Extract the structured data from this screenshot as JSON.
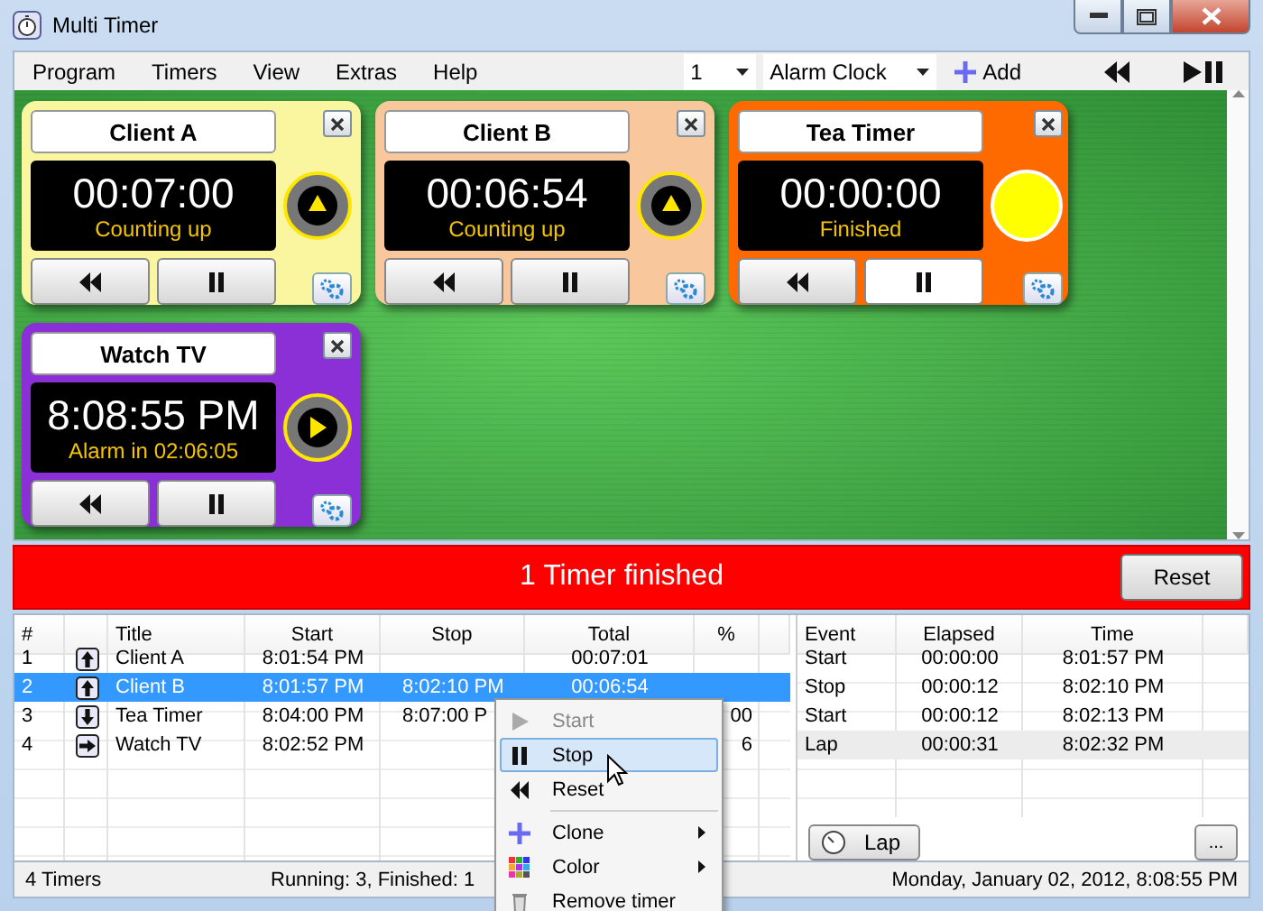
{
  "window": {
    "title": "Multi Timer"
  },
  "menu": [
    "Program",
    "Timers",
    "View",
    "Extras",
    "Help"
  ],
  "toolbar": {
    "count": "1",
    "preset": "Alarm Clock",
    "add": "Add"
  },
  "timers": [
    {
      "title": "Client A",
      "time": "00:07:00",
      "status": "Counting up",
      "color": "#faf6a0",
      "kind": "up"
    },
    {
      "title": "Client B",
      "time": "00:06:54",
      "status": "Counting up",
      "color": "#f8c89c",
      "kind": "up"
    },
    {
      "title": "Tea Timer",
      "time": "00:00:00",
      "status": "Finished",
      "color": "#ff6a00",
      "kind": "done"
    },
    {
      "title": "Watch TV",
      "time": "8:08:55 PM",
      "status": "Alarm in 02:06:05",
      "color": "#8b2fd6",
      "kind": "alarm"
    }
  ],
  "banner": {
    "text": "1 Timer finished",
    "button": "Reset"
  },
  "table": {
    "columns": [
      "#",
      "Title",
      "Start",
      "Stop",
      "Total",
      "%"
    ],
    "rows": [
      {
        "cells": [
          "1",
          "Client A",
          "8:01:54 PM",
          "",
          "00:07:01",
          ""
        ],
        "kind": "up",
        "selected": false
      },
      {
        "cells": [
          "2",
          "Client B",
          "8:01:57 PM",
          "8:02:10 PM",
          "00:06:54",
          ""
        ],
        "kind": "up",
        "selected": true
      },
      {
        "cells": [
          "3",
          "Tea Timer",
          "8:04:00 PM",
          "8:07:00 P",
          "",
          "00"
        ],
        "kind": "down",
        "selected": false
      },
      {
        "cells": [
          "4",
          "Watch TV",
          "8:02:52 PM",
          "",
          "",
          "6"
        ],
        "kind": "right",
        "selected": false
      }
    ]
  },
  "events": {
    "columns": [
      "Event",
      "Elapsed",
      "Time"
    ],
    "rows": [
      {
        "cells": [
          "Start",
          "00:00:00",
          "8:01:57 PM"
        ],
        "selected": false
      },
      {
        "cells": [
          "Stop",
          "00:00:12",
          "8:02:10 PM"
        ],
        "selected": false
      },
      {
        "cells": [
          "Start",
          "00:00:12",
          "8:02:13 PM"
        ],
        "selected": false
      },
      {
        "cells": [
          "Lap",
          "00:00:31",
          "8:02:32 PM"
        ],
        "selected": true
      }
    ],
    "lap": "Lap",
    "more": "..."
  },
  "context_menu": [
    {
      "label": "Start",
      "kind": "play",
      "disabled": true,
      "selected": false
    },
    {
      "label": "Stop",
      "kind": "pause",
      "disabled": false,
      "selected": true
    },
    {
      "label": "Reset",
      "kind": "rewind",
      "disabled": false,
      "selected": false
    },
    {
      "label": "Clone",
      "kind": "plus",
      "disabled": false,
      "selected": false,
      "submenu": true
    },
    {
      "label": "Color",
      "kind": "palette",
      "disabled": false,
      "selected": false,
      "submenu": true
    },
    {
      "label": "Remove timer",
      "kind": "trash",
      "disabled": false,
      "selected": false
    }
  ],
  "status_bar": {
    "count": "4 Timers",
    "summary": "Running: 3, Finished: 1",
    "datetime": "Monday, January 02, 2012, 8:08:55 PM"
  }
}
